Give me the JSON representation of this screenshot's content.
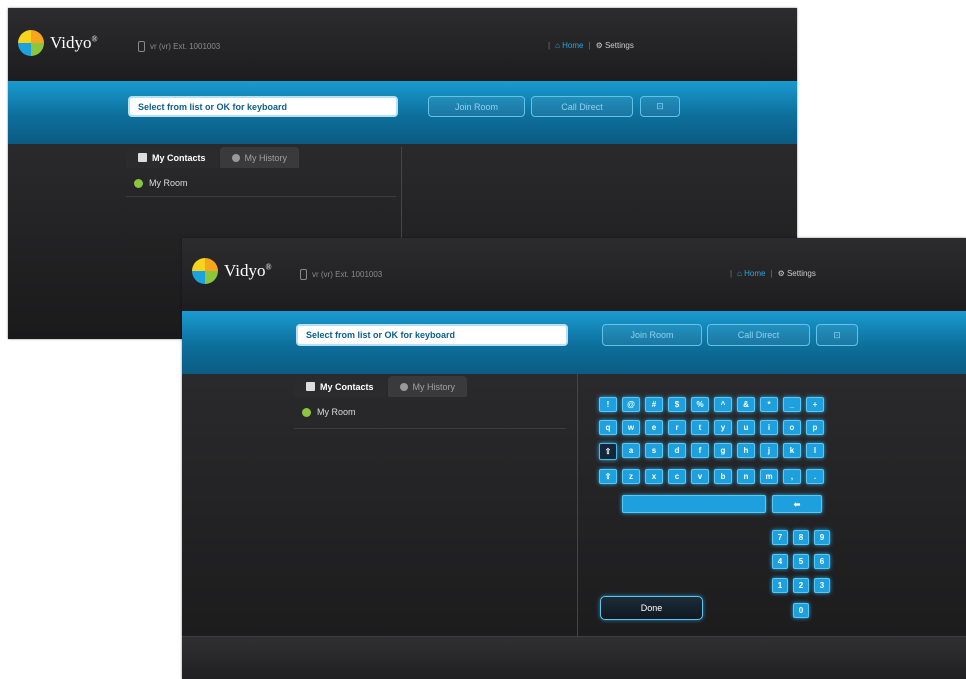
{
  "app": {
    "logo_text": "Vidyo",
    "logo_tm": "®",
    "user_line": "vr (vr) Ext. 1001003"
  },
  "nav": {
    "home": "Home",
    "separator": "|",
    "settings": "Settings"
  },
  "search": {
    "placeholder": "Select from list or OK for keyboard"
  },
  "buttons": {
    "join_room": "Join Room",
    "call_direct": "Call Direct",
    "contact_glyph": "⊡",
    "done": "Done"
  },
  "tabs": [
    {
      "label": "My Contacts",
      "active": true
    },
    {
      "label": "My History",
      "active": false
    }
  ],
  "list": [
    {
      "label": "My Room"
    }
  ],
  "keyboard": {
    "row1": [
      "!",
      "@",
      "#",
      "$",
      "%",
      "^",
      "&",
      "*",
      "_",
      "+"
    ],
    "row2": [
      "q",
      "w",
      "e",
      "r",
      "t",
      "y",
      "u",
      "i",
      "o",
      "p"
    ],
    "row3": [
      "⇧",
      "a",
      "s",
      "d",
      "f",
      "g",
      "h",
      "j",
      "k",
      "l"
    ],
    "row4": [
      "⇧",
      "z",
      "x",
      "c",
      "v",
      "b",
      "n",
      "m",
      ",",
      "."
    ],
    "backspace": "⬅",
    "numpad": [
      "7",
      "8",
      "9",
      "4",
      "5",
      "6",
      "1",
      "2",
      "3",
      "0"
    ]
  },
  "colors": {
    "accent_blue": "#1ea0df",
    "band_blue": "#0d6f9c",
    "background": "#1f1f20"
  }
}
